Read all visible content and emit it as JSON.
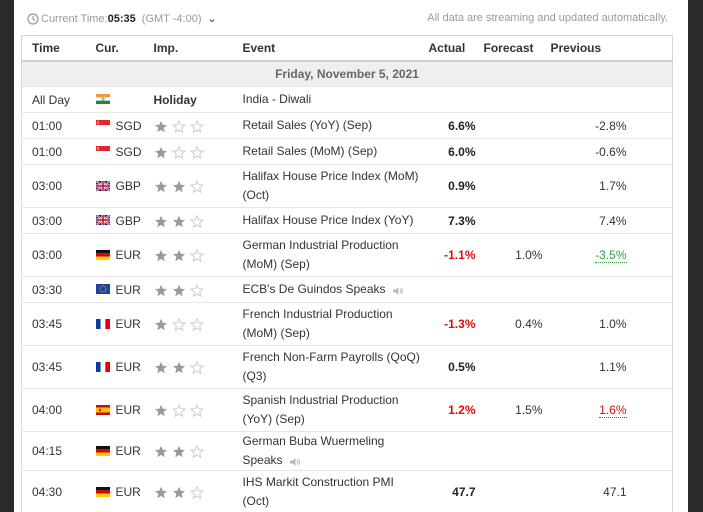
{
  "header": {
    "current_time_label": "Current Time:",
    "current_time": "05:35",
    "timezone": "(GMT -4:00)",
    "streaming_note": "All data are streaming and updated automatically."
  },
  "columns": {
    "time": "Time",
    "currency": "Cur.",
    "importance": "Imp.",
    "event": "Event",
    "actual": "Actual",
    "forecast": "Forecast",
    "previous": "Previous"
  },
  "day_label": "Friday, November 5, 2021",
  "colors": {
    "negative": "#d90e0e",
    "positive_revision": "#2e9f3b",
    "star_filled": "#9a9a9a",
    "star_empty": "#cccccc"
  },
  "rows": [
    {
      "time": "All Day",
      "flag": "in-flag-icon",
      "currency": "",
      "importance_text": "Holiday",
      "stars": 0,
      "event": "India - Diwali",
      "actual": "",
      "actual_state": "black",
      "forecast": "",
      "previous": "",
      "previous_state": "plain",
      "speaker": false
    },
    {
      "time": "01:00",
      "flag": "sg-flag-icon",
      "currency": "SGD",
      "stars": 1,
      "event": "Retail Sales (YoY) (Sep)",
      "actual": "6.6%",
      "actual_state": "black",
      "forecast": "",
      "previous": "-2.8%",
      "previous_state": "plain",
      "speaker": false
    },
    {
      "time": "01:00",
      "flag": "sg-flag-icon",
      "currency": "SGD",
      "stars": 1,
      "event": "Retail Sales (MoM) (Sep)",
      "actual": "6.0%",
      "actual_state": "black",
      "forecast": "",
      "previous": "-0.6%",
      "previous_state": "plain",
      "speaker": false
    },
    {
      "time": "03:00",
      "flag": "gb-flag-icon",
      "currency": "GBP",
      "stars": 2,
      "event": "Halifax House Price Index (MoM) (Oct)",
      "actual": "0.9%",
      "actual_state": "black",
      "forecast": "",
      "previous": "1.7%",
      "previous_state": "plain",
      "speaker": false
    },
    {
      "time": "03:00",
      "flag": "gb-flag-icon",
      "currency": "GBP",
      "stars": 2,
      "event": "Halifax House Price Index (YoY)",
      "actual": "7.3%",
      "actual_state": "black",
      "forecast": "",
      "previous": "7.4%",
      "previous_state": "plain",
      "speaker": false
    },
    {
      "time": "03:00",
      "flag": "de-flag-icon",
      "currency": "EUR",
      "stars": 2,
      "event": "German Industrial Production (MoM) (Sep)",
      "actual": "-1.1%",
      "actual_state": "red",
      "forecast": "1.0%",
      "previous": "-3.5%",
      "previous_state": "green",
      "speaker": false
    },
    {
      "time": "03:30",
      "flag": "eu-flag-icon",
      "currency": "EUR",
      "stars": 2,
      "event": "ECB's De Guindos Speaks",
      "actual": "",
      "actual_state": "black",
      "forecast": "",
      "previous": "",
      "previous_state": "plain",
      "speaker": true
    },
    {
      "time": "03:45",
      "flag": "fr-flag-icon",
      "currency": "EUR",
      "stars": 1,
      "event": "French Industrial Production (MoM) (Sep)",
      "actual": "-1.3%",
      "actual_state": "red",
      "forecast": "0.4%",
      "previous": "1.0%",
      "previous_state": "plain",
      "speaker": false
    },
    {
      "time": "03:45",
      "flag": "fr-flag-icon",
      "currency": "EUR",
      "stars": 2,
      "event": "French Non-Farm Payrolls (QoQ) (Q3)",
      "actual": "0.5%",
      "actual_state": "black",
      "forecast": "",
      "previous": "1.1%",
      "previous_state": "plain",
      "speaker": false
    },
    {
      "time": "04:00",
      "flag": "es-flag-icon",
      "currency": "EUR",
      "stars": 1,
      "event": "Spanish Industrial Production (YoY) (Sep)",
      "actual": "1.2%",
      "actual_state": "red",
      "forecast": "1.5%",
      "previous": "1.6%",
      "previous_state": "red",
      "speaker": false
    },
    {
      "time": "04:15",
      "flag": "de-flag-icon",
      "currency": "EUR",
      "stars": 2,
      "event": "German Buba Wuermeling Speaks",
      "actual": "",
      "actual_state": "black",
      "forecast": "",
      "previous": "",
      "previous_state": "plain",
      "speaker": true
    },
    {
      "time": "04:30",
      "flag": "de-flag-icon",
      "currency": "EUR",
      "stars": 2,
      "event": "IHS Markit Construction PMI (Oct)",
      "actual": "47.7",
      "actual_state": "black",
      "forecast": "",
      "previous": "47.1",
      "previous_state": "plain",
      "speaker": false
    }
  ]
}
